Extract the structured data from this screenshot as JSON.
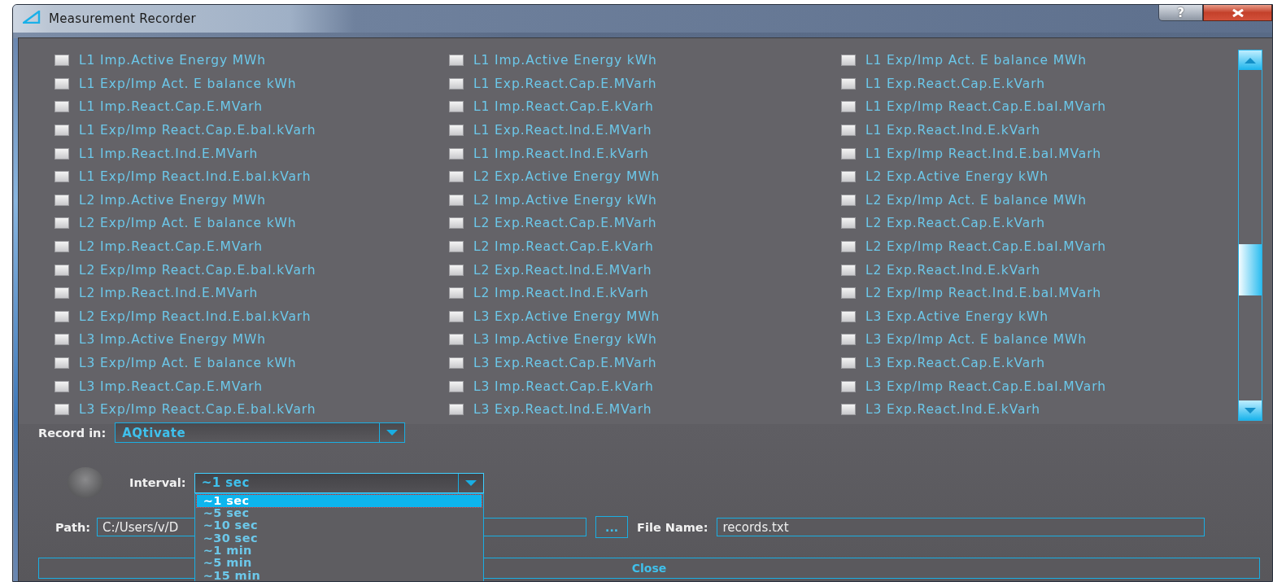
{
  "window": {
    "title": "Measurement Recorder",
    "help_button": "?"
  },
  "checklist": {
    "items": [
      {
        "label": "L1 Imp.Active Energy MWh",
        "checked": false
      },
      {
        "label": "L1 Imp.Active Energy kWh",
        "checked": false
      },
      {
        "label": "L1 Exp/Imp Act. E balance MWh",
        "checked": false
      },
      {
        "label": "L1 Exp/Imp Act. E balance kWh",
        "checked": false
      },
      {
        "label": "L1 Exp.React.Cap.E.MVarh",
        "checked": false
      },
      {
        "label": "L1 Exp.React.Cap.E.kVarh",
        "checked": false
      },
      {
        "label": "L1 Imp.React.Cap.E.MVarh",
        "checked": false
      },
      {
        "label": "L1 Imp.React.Cap.E.kVarh",
        "checked": false
      },
      {
        "label": "L1 Exp/Imp React.Cap.E.bal.MVarh",
        "checked": false
      },
      {
        "label": "L1 Exp/Imp React.Cap.E.bal.kVarh",
        "checked": false
      },
      {
        "label": "L1 Exp.React.Ind.E.MVarh",
        "checked": false
      },
      {
        "label": "L1 Exp.React.Ind.E.kVarh",
        "checked": false
      },
      {
        "label": "L1 Imp.React.Ind.E.MVarh",
        "checked": false
      },
      {
        "label": "L1 Imp.React.Ind.E.kVarh",
        "checked": false
      },
      {
        "label": "L1 Exp/Imp React.Ind.E.bal.MVarh",
        "checked": false
      },
      {
        "label": "L1 Exp/Imp React.Ind.E.bal.kVarh",
        "checked": false
      },
      {
        "label": "L2 Exp.Active Energy MWh",
        "checked": false
      },
      {
        "label": "L2 Exp.Active Energy kWh",
        "checked": false
      },
      {
        "label": "L2 Imp.Active Energy MWh",
        "checked": false
      },
      {
        "label": "L2 Imp.Active Energy kWh",
        "checked": false
      },
      {
        "label": "L2 Exp/Imp Act. E balance MWh",
        "checked": false
      },
      {
        "label": "L2 Exp/Imp Act. E balance kWh",
        "checked": false
      },
      {
        "label": "L2 Exp.React.Cap.E.MVarh",
        "checked": false
      },
      {
        "label": "L2 Exp.React.Cap.E.kVarh",
        "checked": false
      },
      {
        "label": "L2 Imp.React.Cap.E.MVarh",
        "checked": false
      },
      {
        "label": "L2 Imp.React.Cap.E.kVarh",
        "checked": false
      },
      {
        "label": "L2 Exp/Imp React.Cap.E.bal.MVarh",
        "checked": false
      },
      {
        "label": "L2 Exp/Imp React.Cap.E.bal.kVarh",
        "checked": false
      },
      {
        "label": "L2 Exp.React.Ind.E.MVarh",
        "checked": false
      },
      {
        "label": "L2 Exp.React.Ind.E.kVarh",
        "checked": false
      },
      {
        "label": "L2 Imp.React.Ind.E.MVarh",
        "checked": false
      },
      {
        "label": "L2 Imp.React.Ind.E.kVarh",
        "checked": false
      },
      {
        "label": "L2 Exp/Imp React.Ind.E.bal.MVarh",
        "checked": false
      },
      {
        "label": "L2 Exp/Imp React.Ind.E.bal.kVarh",
        "checked": false
      },
      {
        "label": "L3 Exp.Active Energy MWh",
        "checked": false
      },
      {
        "label": "L3 Exp.Active Energy kWh",
        "checked": false
      },
      {
        "label": "L3 Imp.Active Energy MWh",
        "checked": false
      },
      {
        "label": "L3 Imp.Active Energy kWh",
        "checked": false
      },
      {
        "label": "L3 Exp/Imp Act. E balance MWh",
        "checked": false
      },
      {
        "label": "L3 Exp/Imp Act. E balance kWh",
        "checked": false
      },
      {
        "label": "L3 Exp.React.Cap.E.MVarh",
        "checked": false
      },
      {
        "label": "L3 Exp.React.Cap.E.kVarh",
        "checked": false
      },
      {
        "label": "L3 Imp.React.Cap.E.MVarh",
        "checked": false
      },
      {
        "label": "L3 Imp.React.Cap.E.kVarh",
        "checked": false
      },
      {
        "label": "L3 Exp/Imp React.Cap.E.bal.MVarh",
        "checked": false
      },
      {
        "label": "L3 Exp/Imp React.Cap.E.bal.kVarh",
        "checked": false
      },
      {
        "label": "L3 Exp.React.Ind.E.MVarh",
        "checked": false
      },
      {
        "label": "L3 Exp.React.Ind.E.kVarh",
        "checked": false
      }
    ]
  },
  "record_in": {
    "label": "Record in:",
    "value": "AQtivate"
  },
  "recording_led": {
    "on": false
  },
  "interval": {
    "label": "Interval:",
    "value": "~1 sec",
    "expanded": true,
    "options": [
      {
        "label": "~1 sec",
        "selected": true
      },
      {
        "label": "~5 sec",
        "selected": false
      },
      {
        "label": "~10 sec",
        "selected": false
      },
      {
        "label": "~30 sec",
        "selected": false
      },
      {
        "label": "~1 min",
        "selected": false
      },
      {
        "label": "~5 min",
        "selected": false
      },
      {
        "label": "~15 min",
        "selected": false
      }
    ]
  },
  "path": {
    "label": "Path:",
    "value": "C:/Users/v/D"
  },
  "browse_button": "...",
  "file_name": {
    "label": "File Name:",
    "value": "records.txt"
  },
  "close_button": "Close"
}
